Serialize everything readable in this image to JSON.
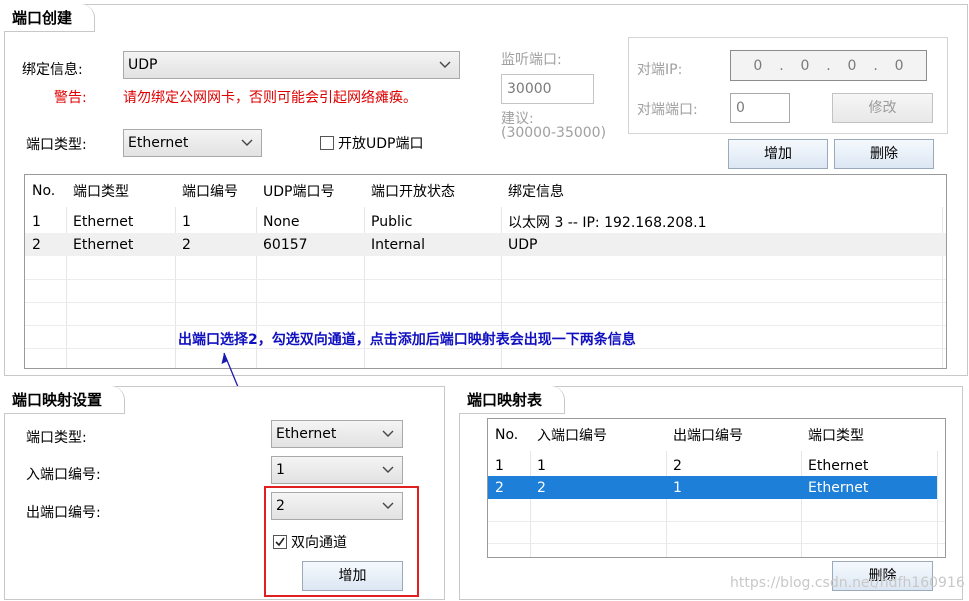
{
  "port_create": {
    "title": "端口创建",
    "bind_label": "绑定信息:",
    "bind_value": "UDP",
    "warning_label": "警告:",
    "warning_text": "请勿绑定公网网卡，否则可能会引起网络瘫痪。",
    "port_type_label": "端口类型:",
    "port_type_value": "Ethernet",
    "open_udp_label": "开放UDP端口",
    "listen_port_label": "监听端口:",
    "listen_port_value": "30000",
    "suggest_label": "建议:",
    "suggest_range": "(30000-35000)",
    "peer_ip_label": "对端IP:",
    "peer_ip": [
      "0",
      "0",
      "0",
      "0"
    ],
    "peer_port_label": "对端端口:",
    "peer_port_value": "0",
    "modify_button": "修改",
    "add_button": "增加",
    "delete_button": "删除",
    "table": {
      "columns": [
        "No.",
        "端口类型",
        "端口编号",
        "UDP端口号",
        "端口开放状态",
        "绑定信息"
      ],
      "rows": [
        [
          "1",
          "Ethernet",
          "1",
          "None",
          "Public",
          "以太网 3 -- IP: 192.168.208.1"
        ],
        [
          "2",
          "Ethernet",
          "2",
          "60157",
          "Internal",
          "UDP"
        ]
      ]
    }
  },
  "annotation": "出端口选择2，勾选双向通道，点击添加后端口映射表会出现一下两条信息",
  "map_settings": {
    "title": "端口映射设置",
    "port_type_label": "端口类型:",
    "port_type_value": "Ethernet",
    "in_port_label": "入端口编号:",
    "in_port_value": "1",
    "out_port_label": "出端口编号:",
    "out_port_value": "2",
    "bidirectional_label": "双向通道",
    "add_button": "增加"
  },
  "map_table": {
    "title": "端口映射表",
    "columns": [
      "No.",
      "入端口编号",
      "出端口编号",
      "端口类型"
    ],
    "rows": [
      [
        "1",
        "1",
        "2",
        "Ethernet"
      ],
      [
        "2",
        "2",
        "1",
        "Ethernet"
      ]
    ],
    "delete_button": "删除"
  },
  "watermark": "https://blog.csdn.net/hdfh160916",
  "colors": {
    "warning": "#e00000",
    "annotation": "#1010c0",
    "selection": "#1e7fd8",
    "highlight_box": "#e02020"
  }
}
